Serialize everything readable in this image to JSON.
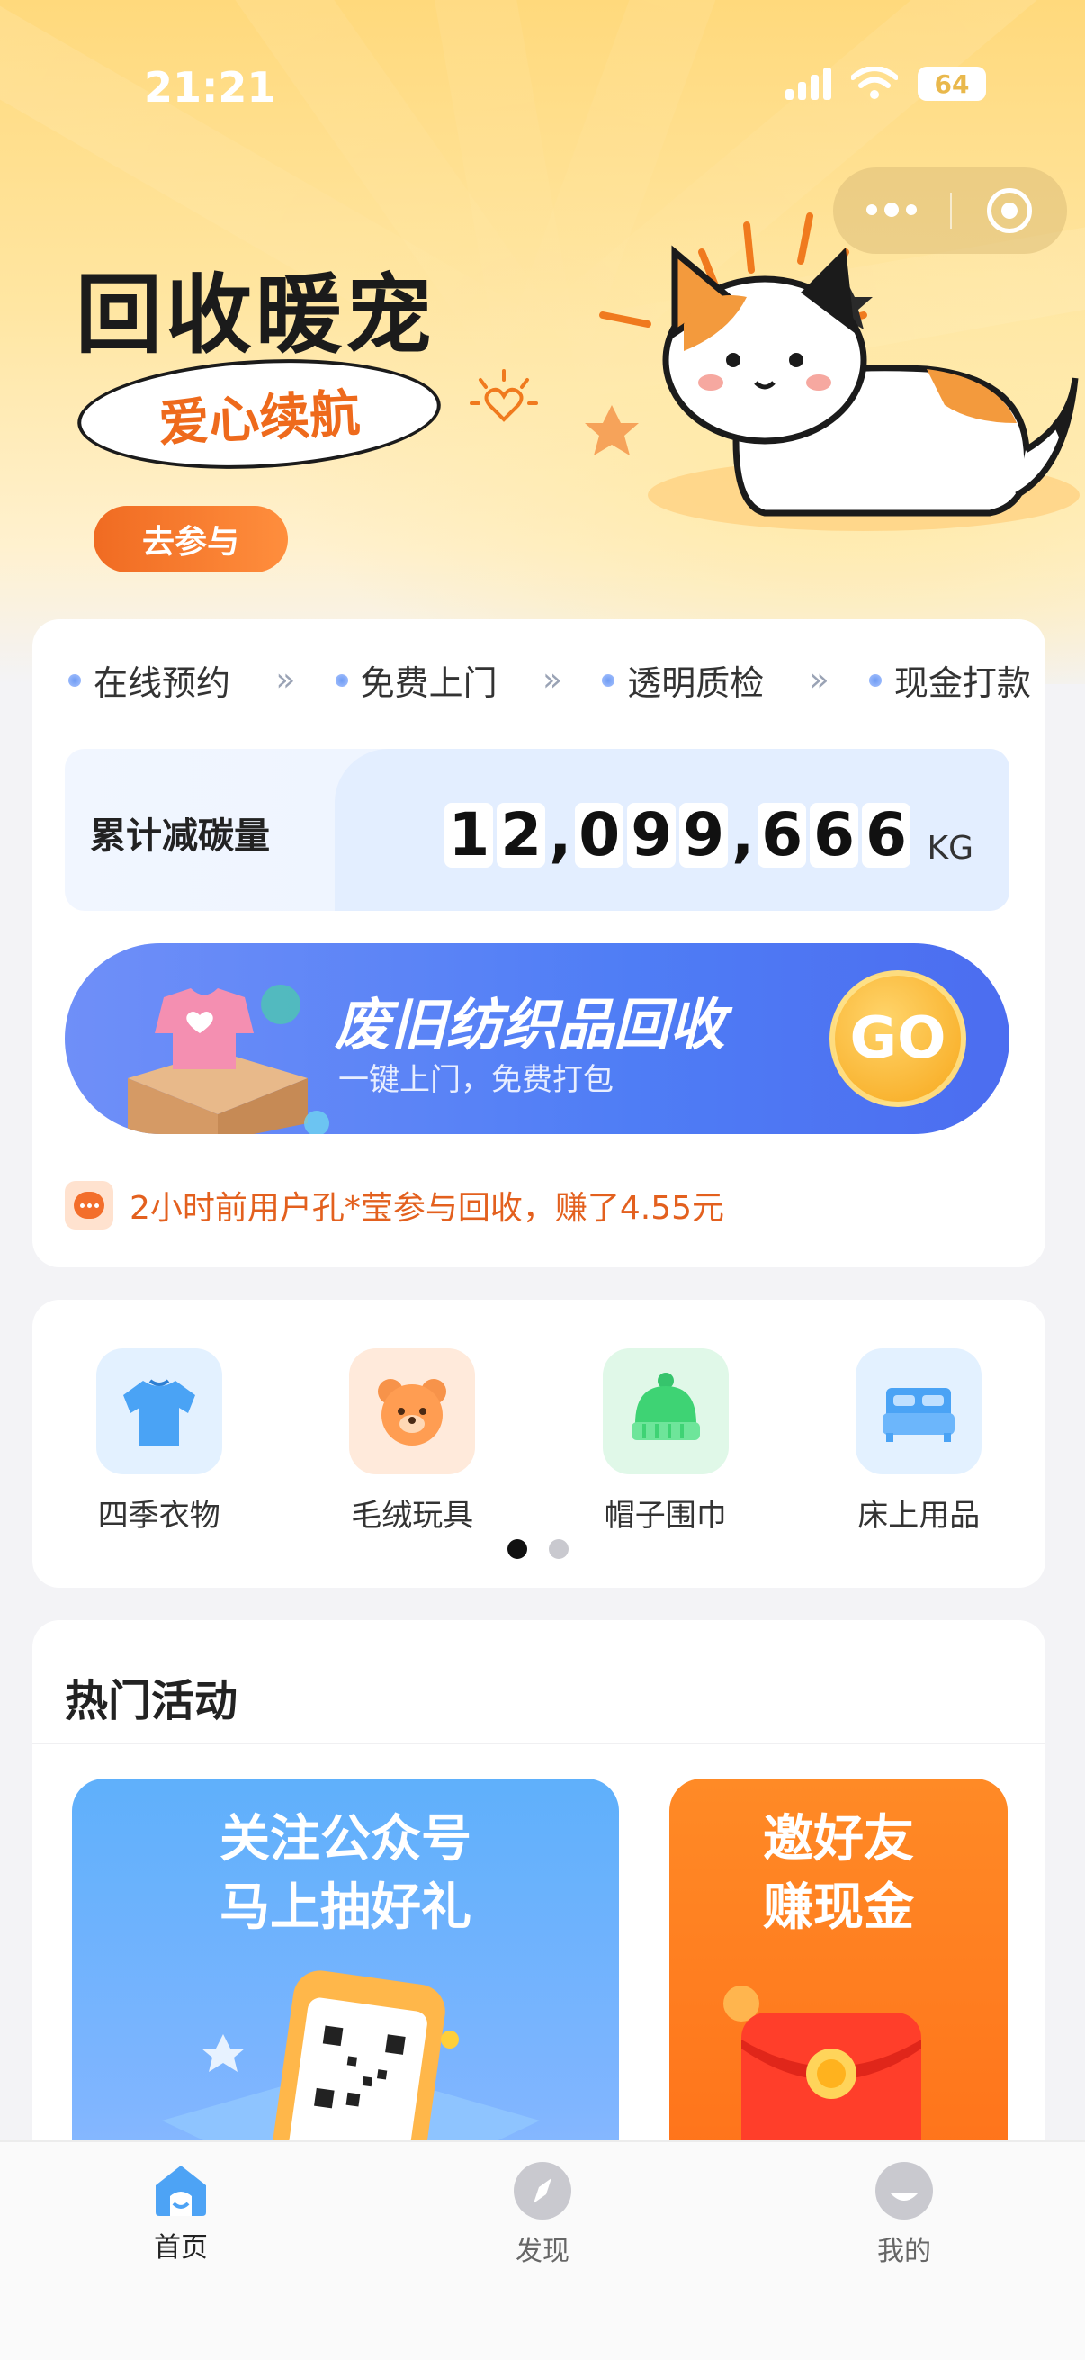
{
  "status_bar": {
    "time": "21:21",
    "battery": "64"
  },
  "hero": {
    "title": "回收暖宠",
    "subtitle": "爱心续航",
    "cta": "去参与"
  },
  "steps": [
    {
      "label": "在线预约"
    },
    {
      "label": "免费上门"
    },
    {
      "label": "透明质检"
    },
    {
      "label": "现金打款"
    }
  ],
  "step_arrow": "»",
  "carbon": {
    "label": "累计减碳量",
    "digits": [
      "1",
      "2",
      ",",
      "0",
      "9",
      "9",
      ",",
      "6",
      "6",
      "6"
    ],
    "unit": "KG"
  },
  "banner": {
    "title": "废旧纺织品回收",
    "subtitle": "一键上门，免费打包",
    "go": "GO"
  },
  "notice": {
    "text": "2小时前用户孔*莹参与回收，赚了4.55元"
  },
  "categories": [
    {
      "label": "四季衣物",
      "icon": "sweater-icon",
      "bg": "#e3f1ff"
    },
    {
      "label": "毛绒玩具",
      "icon": "teddy-bear-icon",
      "bg": "#ffeadb"
    },
    {
      "label": "帽子围巾",
      "icon": "beanie-hat-icon",
      "bg": "#e0f8e8"
    },
    {
      "label": "床上用品",
      "icon": "bed-icon",
      "bg": "#e3f1ff"
    }
  ],
  "hot": {
    "title": "热门活动",
    "promos": [
      {
        "line1": "关注公众号",
        "line2": "马上抽好礼"
      },
      {
        "line1": "邀好友",
        "line2": "赚现金"
      }
    ]
  },
  "tabs": [
    {
      "label": "首页",
      "icon": "home-icon",
      "active": true
    },
    {
      "label": "发现",
      "icon": "compass-icon",
      "active": false
    },
    {
      "label": "我的",
      "icon": "profile-icon",
      "active": false
    }
  ],
  "colors": {
    "accent_orange": "#f06b22",
    "banner_blue": "#4f7df5",
    "notice_orange": "#e3601e",
    "tab_active": "#4da3f5"
  }
}
